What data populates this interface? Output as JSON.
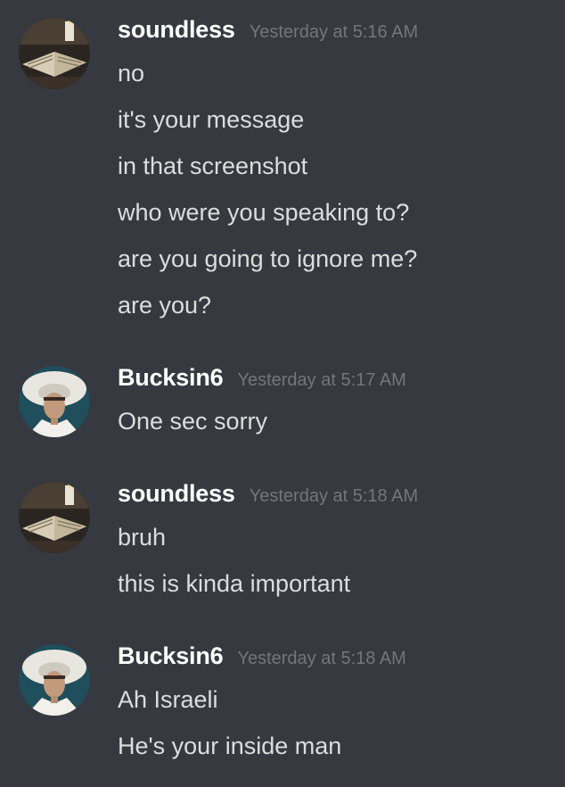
{
  "messages": [
    {
      "username": "soundless",
      "timestamp": "Yesterday at 5:16 AM",
      "avatar_icon": "book-avatar-icon",
      "lines": [
        "no",
        "it's your message",
        "in that screenshot",
        "who were you speaking to?",
        "are you going to ignore me?",
        "are you?"
      ]
    },
    {
      "username": "Bucksin6",
      "timestamp": "Yesterday at 5:17 AM",
      "avatar_icon": "pope-avatar-icon",
      "lines": [
        "One sec sorry"
      ]
    },
    {
      "username": "soundless",
      "timestamp": "Yesterday at 5:18 AM",
      "avatar_icon": "book-avatar-icon",
      "lines": [
        "bruh",
        "this is kinda important"
      ]
    },
    {
      "username": "Bucksin6",
      "timestamp": "Yesterday at 5:18 AM",
      "avatar_icon": "pope-avatar-icon",
      "lines": [
        "Ah Israeli",
        "He's your inside man"
      ]
    }
  ],
  "colors": {
    "background": "#36393f",
    "username": "#ffffff",
    "timestamp": "#72767d",
    "message_text": "#dcddde"
  }
}
